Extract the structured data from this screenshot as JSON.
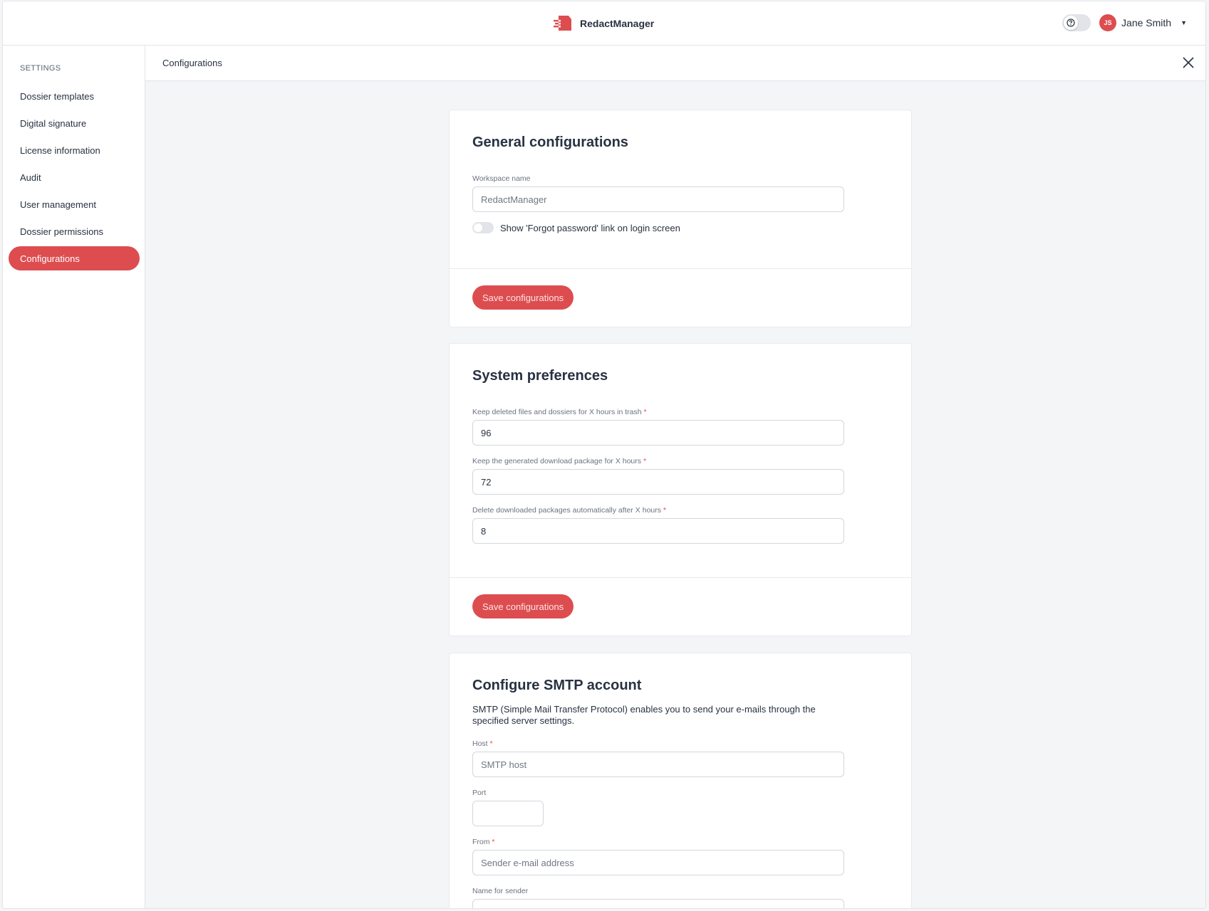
{
  "header": {
    "app_name": "RedactManager",
    "help_icon": "question-circle-icon",
    "user": {
      "initials": "JS",
      "name": "Jane Smith"
    }
  },
  "sidebar": {
    "title": "SETTINGS",
    "items": [
      {
        "label": "Dossier templates",
        "active": false
      },
      {
        "label": "Digital signature",
        "active": false
      },
      {
        "label": "License information",
        "active": false
      },
      {
        "label": "Audit",
        "active": false
      },
      {
        "label": "User management",
        "active": false
      },
      {
        "label": "Dossier permissions",
        "active": false
      },
      {
        "label": "Configurations",
        "active": true
      }
    ]
  },
  "main": {
    "title": "Configurations",
    "general": {
      "heading": "General configurations",
      "workspace_label": "Workspace name",
      "workspace_placeholder": "RedactManager",
      "forgot_toggle_label": "Show 'Forgot password' link on login screen",
      "save_label": "Save configurations"
    },
    "system": {
      "heading": "System preferences",
      "trash_label": "Keep deleted files and dossiers for X hours in trash",
      "trash_value": "96",
      "download_label": "Keep the generated download package for X hours",
      "download_value": "72",
      "delete_label": "Delete downloaded packages automatically after X hours",
      "delete_value": "8",
      "save_label": "Save configurations"
    },
    "smtp": {
      "heading": "Configure SMTP account",
      "description": "SMTP (Simple Mail Transfer Protocol) enables you to send your e-mails through the specified server settings.",
      "host_label": "Host",
      "host_placeholder": "SMTP host",
      "port_label": "Port",
      "from_label": "From",
      "from_placeholder": "Sender e-mail address",
      "sender_name_label": "Name for sender"
    }
  },
  "colors": {
    "accent": "#dd4d50",
    "text": "#283241",
    "background": "#f4f5f7"
  }
}
